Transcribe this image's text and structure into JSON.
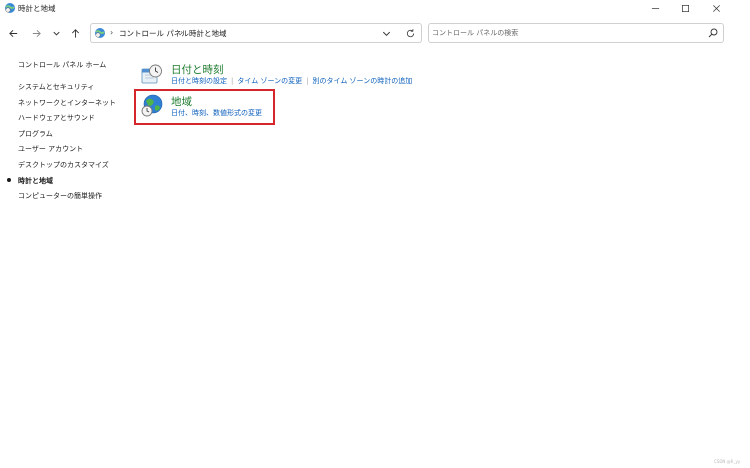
{
  "window": {
    "title": "時計と地域",
    "minimize_icon": "minimize-icon",
    "maximize_icon": "maximize-icon",
    "close_icon": "close-icon"
  },
  "nav": {
    "back_icon": "arrow-left-icon",
    "forward_icon": "arrow-right-icon",
    "recent_icon": "chevron-down-icon",
    "up_icon": "arrow-up-icon"
  },
  "address": {
    "crumbs": [
      "コントロール パネル",
      "時計と地域"
    ],
    "separator": "›"
  },
  "search": {
    "placeholder": "コントロール パネルの検索",
    "value": ""
  },
  "sidebar": {
    "items": [
      {
        "label": "コントロール パネル ホーム",
        "active": false
      },
      {
        "label": "システムとセキュリティ",
        "active": false
      },
      {
        "label": "ネットワークとインターネット",
        "active": false
      },
      {
        "label": "ハードウェアとサウンド",
        "active": false
      },
      {
        "label": "プログラム",
        "active": false
      },
      {
        "label": "ユーザー アカウント",
        "active": false
      },
      {
        "label": "デスクトップのカスタマイズ",
        "active": false
      },
      {
        "label": "時計と地域",
        "active": true
      },
      {
        "label": "コンピューターの簡単操作",
        "active": false
      }
    ]
  },
  "categories": [
    {
      "title": "日付と時刻",
      "icon": "clock-calendar-icon",
      "links": [
        "日付と時刻の設定",
        "タイム ゾーンの変更",
        "別のタイム ゾーンの時計の追加"
      ]
    },
    {
      "title": "地域",
      "icon": "globe-clock-icon",
      "links": [
        "日付、時刻、数値形式の変更"
      ]
    }
  ],
  "colors": {
    "category_title": "#1e7b2e",
    "link": "#0b5fbd",
    "highlight": "#d6262b"
  },
  "watermark": "CSDN @R_yy"
}
